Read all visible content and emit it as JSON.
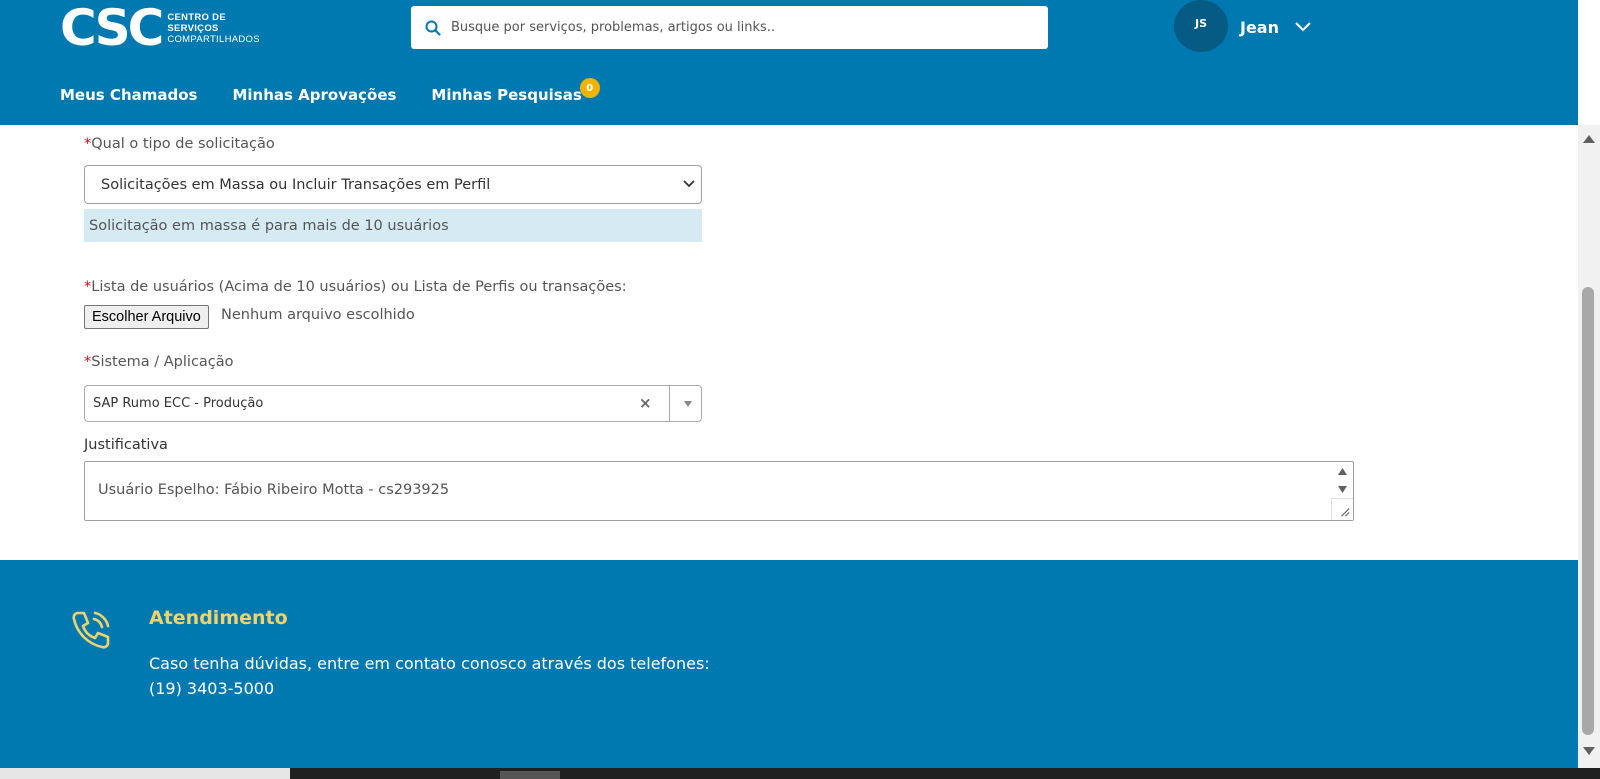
{
  "header": {
    "logo": {
      "main": "CSC",
      "line1": "CENTRO DE",
      "line2": "SERVIÇOS",
      "line3": "COMPARTILHADOS"
    },
    "search": {
      "placeholder": "Busque por serviços, problemas, artigos ou links..",
      "icon": "search-icon"
    },
    "user": {
      "initials": "JS",
      "name": "Jean"
    },
    "nav": [
      {
        "label": "Meus Chamados"
      },
      {
        "label": "Minhas Aprovações"
      },
      {
        "label": "Minhas Pesquisas",
        "badge": "0"
      }
    ],
    "colors": {
      "brand": "#0079b0",
      "badge": "#f0b400",
      "avatar": "#065b85"
    }
  },
  "form": {
    "required_marker": "*",
    "request_type": {
      "label": "Qual o tipo de solicitação",
      "value": "Solicitações em Massa ou Incluir Transações em Perfil",
      "info": "Solicitação em massa é para mais de 10 usuários"
    },
    "user_list": {
      "label": "Lista de usuários (Acima de 10 usuários) ou Lista de Perfis ou transações:",
      "button": "Escolher Arquivo",
      "status": "Nenhum arquivo escolhido"
    },
    "system": {
      "label": "Sistema / Aplicação",
      "value": "SAP Rumo ECC - Produção",
      "clear": "×"
    },
    "justification": {
      "label": "Justificativa",
      "value": "Usuário Espelho: Fábio Ribeiro Motta - cs293925"
    }
  },
  "footer": {
    "title": "Atendimento",
    "line1": "Caso tenha dúvidas, entre em contato conosco através dos telefones:",
    "line2": "(19) 3403-5000",
    "icon": "phone-icon",
    "colors": {
      "title": "#f2d26b"
    }
  }
}
